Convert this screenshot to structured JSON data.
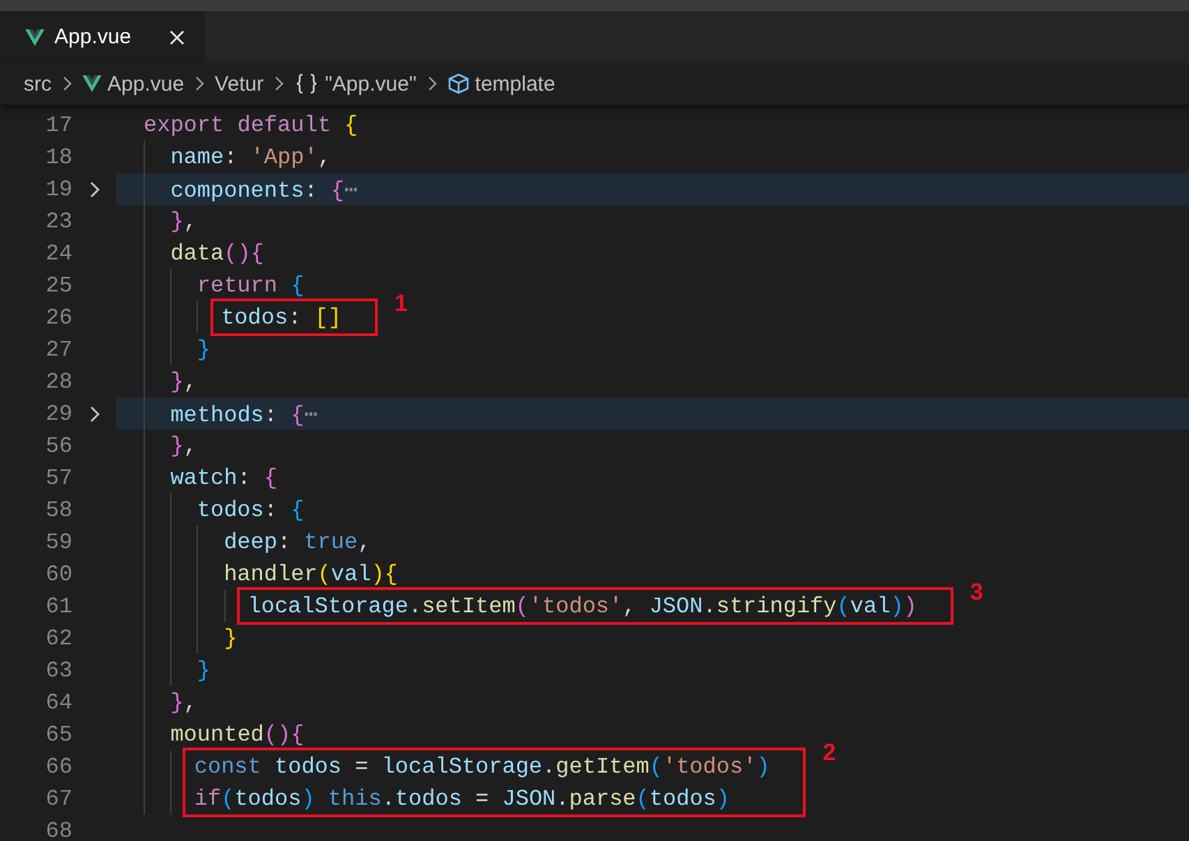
{
  "tabs": [
    {
      "label": "App.vue",
      "selected": true
    }
  ],
  "breadcrumbs": [
    {
      "label": "src"
    },
    {
      "label": "App.vue"
    },
    {
      "label": "Vetur"
    },
    {
      "label": "\"App.vue\""
    },
    {
      "label": "template"
    }
  ],
  "lines": [
    {
      "number": "17",
      "folded": false,
      "tokens": [
        {
          "kind": "kw",
          "text": "export"
        },
        {
          "kind": "kw",
          "text": " default "
        },
        {
          "kind": "b1",
          "text": "{"
        }
      ]
    },
    {
      "number": "18",
      "folded": false,
      "tokens": [
        {
          "kind": "key",
          "text": "  name"
        },
        {
          "kind": "p",
          "text": ": "
        },
        {
          "kind": "str",
          "text": "'App'"
        },
        {
          "kind": "p",
          "text": ","
        }
      ]
    },
    {
      "number": "19",
      "folded": true,
      "tokens": [
        {
          "kind": "key",
          "text": "  components"
        },
        {
          "kind": "p",
          "text": ": "
        },
        {
          "kind": "b2",
          "text": "{"
        },
        {
          "kind": "dots",
          "text": "⋯"
        }
      ]
    },
    {
      "number": "23",
      "folded": false,
      "tokens": [
        {
          "kind": "b2",
          "text": "  }"
        },
        {
          "kind": "p",
          "text": ","
        }
      ]
    },
    {
      "number": "24",
      "folded": false,
      "tokens": [
        {
          "kind": "fn",
          "text": "  data"
        },
        {
          "kind": "b2",
          "text": "(){"
        }
      ]
    },
    {
      "number": "25",
      "folded": false,
      "tokens": [
        {
          "kind": "kw",
          "text": "    return "
        },
        {
          "kind": "b3",
          "text": "{"
        }
      ]
    },
    {
      "number": "26",
      "folded": false,
      "annotation": "1",
      "tokens": [
        {
          "kind": "key",
          "text": "      todos"
        },
        {
          "kind": "p",
          "text": ": "
        },
        {
          "kind": "b1",
          "text": "[]"
        }
      ]
    },
    {
      "number": "27",
      "folded": false,
      "tokens": [
        {
          "kind": "b3",
          "text": "    }"
        }
      ]
    },
    {
      "number": "28",
      "folded": false,
      "tokens": [
        {
          "kind": "b2",
          "text": "  }"
        },
        {
          "kind": "p",
          "text": ","
        }
      ]
    },
    {
      "number": "29",
      "folded": true,
      "tokens": [
        {
          "kind": "key",
          "text": "  methods"
        },
        {
          "kind": "p",
          "text": ": "
        },
        {
          "kind": "b2",
          "text": "{"
        },
        {
          "kind": "dots",
          "text": "⋯"
        }
      ]
    },
    {
      "number": "56",
      "folded": false,
      "tokens": [
        {
          "kind": "b2",
          "text": "  }"
        },
        {
          "kind": "p",
          "text": ","
        }
      ]
    },
    {
      "number": "57",
      "folded": false,
      "tokens": [
        {
          "kind": "key",
          "text": "  watch"
        },
        {
          "kind": "p",
          "text": ": "
        },
        {
          "kind": "b2",
          "text": "{"
        }
      ]
    },
    {
      "number": "58",
      "folded": false,
      "tokens": [
        {
          "kind": "key",
          "text": "    todos"
        },
        {
          "kind": "p",
          "text": ": "
        },
        {
          "kind": "b3",
          "text": "{"
        }
      ]
    },
    {
      "number": "59",
      "folded": false,
      "tokens": [
        {
          "kind": "key",
          "text": "      deep"
        },
        {
          "kind": "p",
          "text": ": "
        },
        {
          "kind": "stor",
          "text": "true"
        },
        {
          "kind": "p",
          "text": ","
        }
      ]
    },
    {
      "number": "60",
      "folded": false,
      "tokens": [
        {
          "kind": "fn",
          "text": "      handler"
        },
        {
          "kind": "b1",
          "text": "("
        },
        {
          "kind": "var",
          "text": "val"
        },
        {
          "kind": "b1",
          "text": "){"
        }
      ]
    },
    {
      "number": "61",
      "folded": false,
      "annotation": "3",
      "tokens": [
        {
          "kind": "var",
          "text": "        localStorage"
        },
        {
          "kind": "p",
          "text": "."
        },
        {
          "kind": "fn",
          "text": "setItem"
        },
        {
          "kind": "b2",
          "text": "("
        },
        {
          "kind": "str",
          "text": "'todos'"
        },
        {
          "kind": "p",
          "text": ", "
        },
        {
          "kind": "var",
          "text": "JSON"
        },
        {
          "kind": "p",
          "text": "."
        },
        {
          "kind": "fn",
          "text": "stringify"
        },
        {
          "kind": "b3",
          "text": "("
        },
        {
          "kind": "var",
          "text": "val"
        },
        {
          "kind": "b3",
          "text": ")"
        },
        {
          "kind": "b2",
          "text": ")"
        }
      ]
    },
    {
      "number": "62",
      "folded": false,
      "tokens": [
        {
          "kind": "b1",
          "text": "      }"
        }
      ]
    },
    {
      "number": "63",
      "folded": false,
      "tokens": [
        {
          "kind": "b3",
          "text": "    }"
        }
      ]
    },
    {
      "number": "64",
      "folded": false,
      "tokens": [
        {
          "kind": "b2",
          "text": "  }"
        },
        {
          "kind": "p",
          "text": ","
        }
      ]
    },
    {
      "number": "65",
      "folded": false,
      "tokens": [
        {
          "kind": "fn",
          "text": "  mounted"
        },
        {
          "kind": "b2",
          "text": "(){"
        }
      ]
    },
    {
      "number": "66",
      "folded": false,
      "annotation": "2",
      "tokens": [
        {
          "kind": "stor",
          "text": "    const "
        },
        {
          "kind": "var",
          "text": "todos"
        },
        {
          "kind": "p",
          "text": " = "
        },
        {
          "kind": "var",
          "text": "localStorage"
        },
        {
          "kind": "p",
          "text": "."
        },
        {
          "kind": "fn",
          "text": "getItem"
        },
        {
          "kind": "b3",
          "text": "("
        },
        {
          "kind": "str",
          "text": "'todos'"
        },
        {
          "kind": "b3",
          "text": ")"
        }
      ]
    },
    {
      "number": "67",
      "folded": false,
      "boxed_with_previous": true,
      "tokens": [
        {
          "kind": "kw",
          "text": "    if"
        },
        {
          "kind": "b3",
          "text": "("
        },
        {
          "kind": "var",
          "text": "todos"
        },
        {
          "kind": "b3",
          "text": ") "
        },
        {
          "kind": "stor",
          "text": "this"
        },
        {
          "kind": "p",
          "text": "."
        },
        {
          "kind": "var",
          "text": "todos"
        },
        {
          "kind": "p",
          "text": " = "
        },
        {
          "kind": "var",
          "text": "JSON"
        },
        {
          "kind": "p",
          "text": "."
        },
        {
          "kind": "fn",
          "text": "parse"
        },
        {
          "kind": "b3",
          "text": "("
        },
        {
          "kind": "var",
          "text": "todos"
        },
        {
          "kind": "b3",
          "text": ")"
        }
      ]
    },
    {
      "number": "68",
      "folded": false
    }
  ]
}
